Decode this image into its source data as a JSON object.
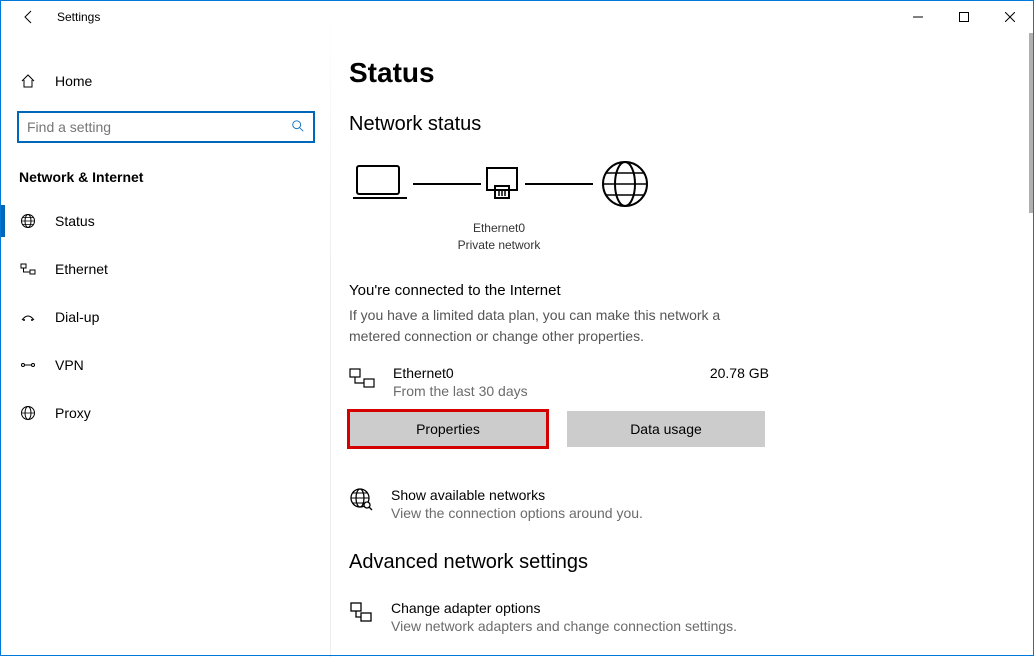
{
  "window": {
    "title": "Settings"
  },
  "sidebar": {
    "home": "Home",
    "search_placeholder": "Find a setting",
    "group": "Network & Internet",
    "items": [
      {
        "label": "Status"
      },
      {
        "label": "Ethernet"
      },
      {
        "label": "Dial-up"
      },
      {
        "label": "VPN"
      },
      {
        "label": "Proxy"
      }
    ]
  },
  "main": {
    "title": "Status",
    "section1": "Network status",
    "diagram": {
      "adapter": "Ethernet0",
      "network_type": "Private network"
    },
    "connected_title": "You're connected to the Internet",
    "connected_sub": "If you have a limited data plan, you can make this network a metered connection or change other properties.",
    "adapter": {
      "name": "Ethernet0",
      "sub": "From the last 30 days",
      "usage": "20.78 GB"
    },
    "buttons": {
      "properties": "Properties",
      "data_usage": "Data usage"
    },
    "available": {
      "title": "Show available networks",
      "sub": "View the connection options around you."
    },
    "section2": "Advanced network settings",
    "adapter_options": {
      "title": "Change adapter options",
      "sub": "View network adapters and change connection settings."
    }
  }
}
